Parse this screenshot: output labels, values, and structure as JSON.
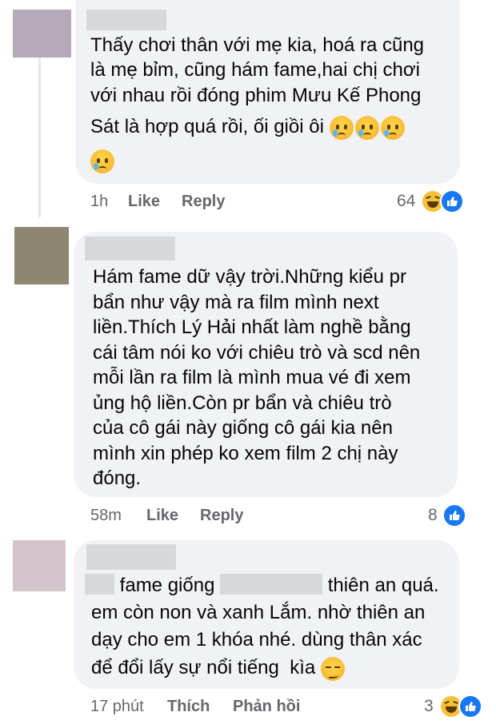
{
  "comments": [
    {
      "lines": [
        "Thấy chơi thân với mẹ kia, hoá ra cũng",
        "là mẹ bỉm, cũng hám fame,hai chị chơi",
        "với nhau rồi đóng phim Mưu Kế Phong",
        "Sát là hợp quá rồi, ối giồi ôi"
      ],
      "emoji": "loudly-crying-face",
      "time": "1h",
      "like": "Like",
      "reply": "Reply",
      "reaction_count": "64",
      "reactions": [
        "haha",
        "like"
      ],
      "avatar_color": "#b6aaba"
    },
    {
      "lines": [
        "Hám fame dữ vậy trời.Những kiểu pr",
        "bẩn như vậy mà ra film mình next",
        "liền.Thích Lý Hải nhất làm nghề bằng",
        "cái tâm nói ko với chiêu trò và scd nên",
        "mỗi lần ra film là mình mua vé đi xem",
        "ủng hộ liền.Còn pr bẩn và chiêu trò",
        "của cô gái này giống cô gái kia nên",
        "mình xin phép ko xem film 2 chị này",
        "đóng."
      ],
      "time": "58m",
      "like": "Like",
      "reply": "Reply",
      "reaction_count": "8",
      "reactions": [
        "like"
      ],
      "avatar_color": "#8e8670"
    },
    {
      "line1_seg": "fame giống",
      "line1_end": "thiên an quá.",
      "lines_rest": [
        "em còn non và xanh Lắm. nhờ thiên an",
        "dạy cho em 1 khóa nhé. dùng thân xác"
      ],
      "last_line": "để đổi lấy sự nổi tiếng  kìa",
      "emoji": "smirking-face",
      "time": "17 phút",
      "like": "Thích",
      "reply": "Phản hồi",
      "reaction_count": "3",
      "reactions": [
        "haha",
        "like"
      ],
      "avatar_color": "#d4c4cc"
    }
  ],
  "colors": {
    "bubble": "#f0f2f5",
    "redaction": "#d6d8dc",
    "meta_text": "#65676b",
    "like_blue": "#1877f2",
    "haha_yellow": "#f7c13c"
  }
}
